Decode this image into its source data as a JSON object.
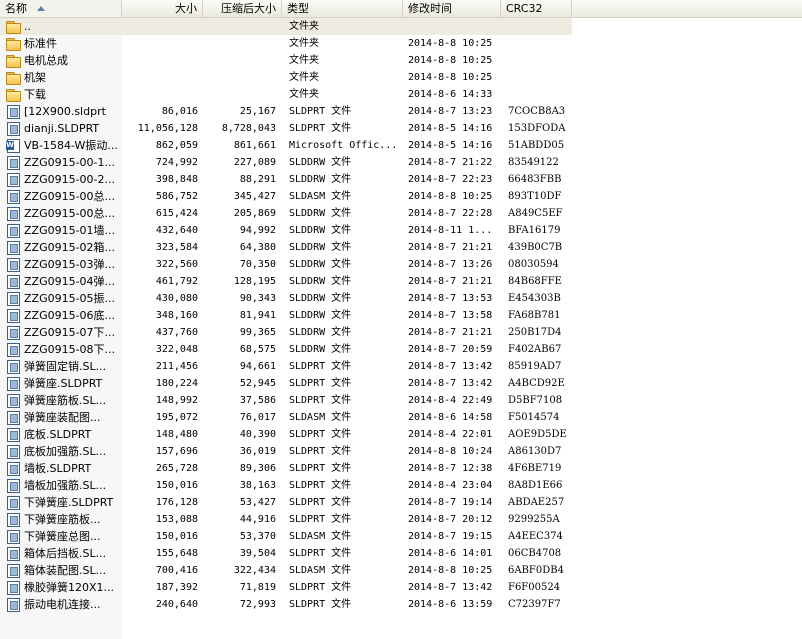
{
  "columns": {
    "name": "名称",
    "size": "大小",
    "compressed": "压缩后大小",
    "type": "类型",
    "modified": "修改时间",
    "crc": "CRC32"
  },
  "rows": [
    {
      "icon": "folder-icon",
      "name": "..",
      "size": "",
      "compressed": "",
      "type": "文件夹",
      "modified": "",
      "crc": ""
    },
    {
      "icon": "folder-icon",
      "name": "标准件",
      "size": "",
      "compressed": "",
      "type": "文件夹",
      "modified": "2014-8-8 10:25",
      "crc": ""
    },
    {
      "icon": "folder-icon",
      "name": "电机总成",
      "size": "",
      "compressed": "",
      "type": "文件夹",
      "modified": "2014-8-8 10:25",
      "crc": ""
    },
    {
      "icon": "folder-icon",
      "name": "机架",
      "size": "",
      "compressed": "",
      "type": "文件夹",
      "modified": "2014-8-8 10:25",
      "crc": ""
    },
    {
      "icon": "folder-icon",
      "name": "下载",
      "size": "",
      "compressed": "",
      "type": "文件夹",
      "modified": "2014-8-6 14:33",
      "crc": ""
    },
    {
      "icon": "file-icon",
      "name": "[12X900.sldprt",
      "size": "86,016",
      "compressed": "25,167",
      "type": "SLDPRT 文件",
      "modified": "2014-8-7 13:23",
      "crc": "7COCB8A3"
    },
    {
      "icon": "file-icon",
      "name": "dianji.SLDPRT",
      "size": "11,056,128",
      "compressed": "8,728,043",
      "type": "SLDPRT 文件",
      "modified": "2014-8-5 14:16",
      "crc": "153DFODA"
    },
    {
      "icon": "doc-icon",
      "name": "VB-1584-W振动...",
      "size": "862,059",
      "compressed": "861,661",
      "type": "Microsoft Offic...",
      "modified": "2014-8-5 14:16",
      "crc": "51ABDD05"
    },
    {
      "icon": "file-icon",
      "name": "ZZG0915-00-1...",
      "size": "724,992",
      "compressed": "227,089",
      "type": "SLDDRW 文件",
      "modified": "2014-8-7 21:22",
      "crc": "83549122"
    },
    {
      "icon": "file-icon",
      "name": "ZZG0915-00-2...",
      "size": "398,848",
      "compressed": "88,291",
      "type": "SLDDRW 文件",
      "modified": "2014-8-7 22:23",
      "crc": "66483FBB"
    },
    {
      "icon": "file-icon",
      "name": "ZZG0915-00总...",
      "size": "586,752",
      "compressed": "345,427",
      "type": "SLDASM 文件",
      "modified": "2014-8-8 10:25",
      "crc": "893T10DF"
    },
    {
      "icon": "file-icon",
      "name": "ZZG0915-00总...",
      "size": "615,424",
      "compressed": "205,869",
      "type": "SLDDRW 文件",
      "modified": "2014-8-7 22:28",
      "crc": "A849C5EF"
    },
    {
      "icon": "file-icon",
      "name": "ZZG0915-01墙...",
      "size": "432,640",
      "compressed": "94,992",
      "type": "SLDDRW 文件",
      "modified": "2014-8-11 1...",
      "crc": "BFA16179"
    },
    {
      "icon": "file-icon",
      "name": "ZZG0915-02箱...",
      "size": "323,584",
      "compressed": "64,380",
      "type": "SLDDRW 文件",
      "modified": "2014-8-7 21:21",
      "crc": "439B0C7B"
    },
    {
      "icon": "file-icon",
      "name": "ZZG0915-03弹...",
      "size": "322,560",
      "compressed": "70,350",
      "type": "SLDDRW 文件",
      "modified": "2014-8-7 13:26",
      "crc": "08030594"
    },
    {
      "icon": "file-icon",
      "name": "ZZG0915-04弹...",
      "size": "461,792",
      "compressed": "128,195",
      "type": "SLDDRW 文件",
      "modified": "2014-8-7 21:21",
      "crc": "84B68FFE"
    },
    {
      "icon": "file-icon",
      "name": "ZZG0915-05振...",
      "size": "430,080",
      "compressed": "90,343",
      "type": "SLDDRW 文件",
      "modified": "2014-8-7 13:53",
      "crc": "E454303B"
    },
    {
      "icon": "file-icon",
      "name": "ZZG0915-06底...",
      "size": "348,160",
      "compressed": "81,941",
      "type": "SLDDRW 文件",
      "modified": "2014-8-7 13:58",
      "crc": "FA68B781"
    },
    {
      "icon": "file-icon",
      "name": "ZZG0915-07下...",
      "size": "437,760",
      "compressed": "99,365",
      "type": "SLDDRW 文件",
      "modified": "2014-8-7 21:21",
      "crc": "250B17D4"
    },
    {
      "icon": "file-icon",
      "name": "ZZG0915-08下...",
      "size": "322,048",
      "compressed": "68,575",
      "type": "SLDDRW 文件",
      "modified": "2014-8-7 20:59",
      "crc": "F402AB67"
    },
    {
      "icon": "file-icon",
      "name": "弹簧固定销.SL...",
      "size": "211,456",
      "compressed": "94,661",
      "type": "SLDPRT 文件",
      "modified": "2014-8-7 13:42",
      "crc": "85919AD7"
    },
    {
      "icon": "file-icon",
      "name": "弹簧座.SLDPRT",
      "size": "180,224",
      "compressed": "52,945",
      "type": "SLDPRT 文件",
      "modified": "2014-8-7 13:42",
      "crc": "A4BCD92E"
    },
    {
      "icon": "file-icon",
      "name": "弹簧座筋板.SL...",
      "size": "148,992",
      "compressed": "37,586",
      "type": "SLDPRT 文件",
      "modified": "2014-8-4 22:49",
      "crc": "D5BF7108"
    },
    {
      "icon": "file-icon",
      "name": "弹簧座装配图...",
      "size": "195,072",
      "compressed": "76,017",
      "type": "SLDASM 文件",
      "modified": "2014-8-6 14:58",
      "crc": "F5014574"
    },
    {
      "icon": "file-icon",
      "name": "底板.SLDPRT",
      "size": "148,480",
      "compressed": "40,390",
      "type": "SLDPRT 文件",
      "modified": "2014-8-4 22:01",
      "crc": "AOE9D5DE"
    },
    {
      "icon": "file-icon",
      "name": "底板加强筋.SL...",
      "size": "157,696",
      "compressed": "36,019",
      "type": "SLDPRT 文件",
      "modified": "2014-8-8 10:24",
      "crc": "A86130D7"
    },
    {
      "icon": "file-icon",
      "name": "墙板.SLDPRT",
      "size": "265,728",
      "compressed": "89,306",
      "type": "SLDPRT 文件",
      "modified": "2014-8-7 12:38",
      "crc": "4F6BE719"
    },
    {
      "icon": "file-icon",
      "name": "墙板加强筋.SL...",
      "size": "150,016",
      "compressed": "38,163",
      "type": "SLDPRT 文件",
      "modified": "2014-8-4 23:04",
      "crc": "8A8D1E66"
    },
    {
      "icon": "file-icon",
      "name": "下弹簧座.SLDPRT",
      "size": "176,128",
      "compressed": "53,427",
      "type": "SLDPRT 文件",
      "modified": "2014-8-7 19:14",
      "crc": "ABDAE257"
    },
    {
      "icon": "file-icon",
      "name": "下弹簧座筋板...",
      "size": "153,088",
      "compressed": "44,916",
      "type": "SLDPRT 文件",
      "modified": "2014-8-7 20:12",
      "crc": "9299255A"
    },
    {
      "icon": "file-icon",
      "name": "下弹簧座总图...",
      "size": "150,016",
      "compressed": "53,370",
      "type": "SLDASM 文件",
      "modified": "2014-8-7 19:15",
      "crc": "A4EEC374"
    },
    {
      "icon": "file-icon",
      "name": "箱体后挡板.SL...",
      "size": "155,648",
      "compressed": "39,504",
      "type": "SLDPRT 文件",
      "modified": "2014-8-6 14:01",
      "crc": "06CB4708"
    },
    {
      "icon": "file-icon",
      "name": "箱体装配图.SL...",
      "size": "700,416",
      "compressed": "322,434",
      "type": "SLDASM 文件",
      "modified": "2014-8-8 10:25",
      "crc": "6ABF0DB4"
    },
    {
      "icon": "file-icon",
      "name": "橡胶弹簧120X1...",
      "size": "187,392",
      "compressed": "71,819",
      "type": "SLDPRT 文件",
      "modified": "2014-8-7 13:42",
      "crc": "F6F00524"
    },
    {
      "icon": "file-icon",
      "name": "振动电机连接...",
      "size": "240,640",
      "compressed": "72,993",
      "type": "SLDPRT 文件",
      "modified": "2014-8-6 13:59",
      "crc": "C72397F7"
    }
  ]
}
